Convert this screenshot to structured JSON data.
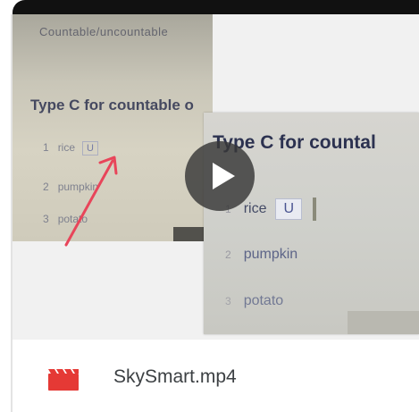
{
  "preview": {
    "left_photo": {
      "top_text": "Countable/uncountable",
      "heading": "Type C for countable o",
      "rows": [
        {
          "num": "1",
          "word": "rice",
          "answer": "U"
        },
        {
          "num": "2",
          "word": "pumpkin"
        },
        {
          "num": "3",
          "word": "potato"
        }
      ]
    },
    "right_photo": {
      "heading": "Type C for countal",
      "rows": [
        {
          "num": "1",
          "word": "rice",
          "answer": "U"
        },
        {
          "num": "2",
          "word": "pumpkin"
        },
        {
          "num": "3",
          "word": "potato"
        }
      ]
    },
    "play_icon": "play-icon",
    "arrow_color": "#e8455a"
  },
  "file": {
    "icon": "video-file-icon",
    "icon_color": "#e53935",
    "name": "SkySmart.mp4"
  }
}
